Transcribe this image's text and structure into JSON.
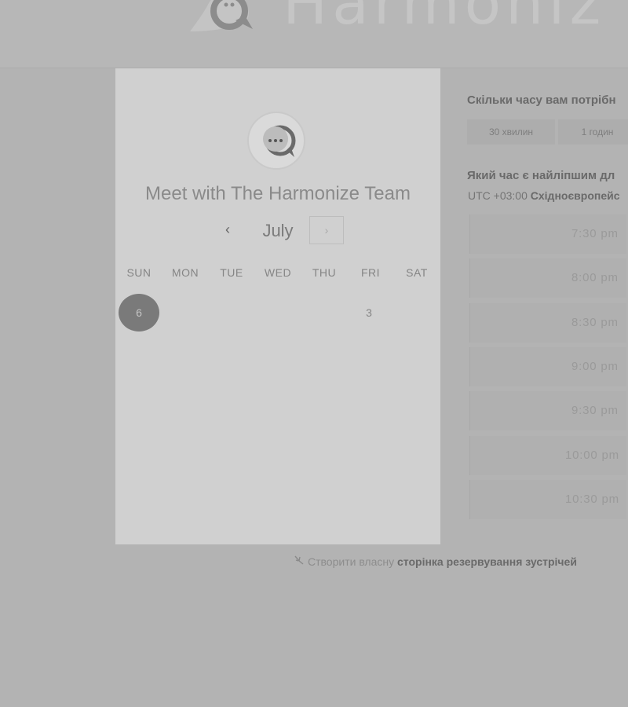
{
  "header": {
    "brand_name": "Harmoniz"
  },
  "card": {
    "title": "Meet with The Harmonize Team",
    "month": "July",
    "prev_glyph": "‹",
    "next_glyph": "›",
    "weekdays": [
      "SUN",
      "MON",
      "TUE",
      "WED",
      "THU",
      "FRI",
      "SAT"
    ],
    "days": [
      {
        "label": "6",
        "selected": true
      },
      {
        "label": "3",
        "selected": false
      }
    ]
  },
  "panel": {
    "duration_question": "Скільки часу вам потрібн",
    "durations": [
      "30 хвилин",
      "1 годин"
    ],
    "time_question": "Який час є найліпшим дл",
    "timezone_offset": "UTC +03:00",
    "timezone_name": "Східноєвропейс",
    "slots": [
      "7:30 pm",
      "8:00 pm",
      "8:30 pm",
      "9:00 pm",
      "9:30 pm",
      "10:00 pm",
      "10:30 pm"
    ]
  },
  "footer": {
    "link_prefix": "Створити власну",
    "link_bold": "сторінка резервування зустрічей"
  },
  "colors": {
    "selected_day": "#7a7a7a",
    "card_bg": "#d0d0d0",
    "page_bg": "#b3b3b3"
  }
}
